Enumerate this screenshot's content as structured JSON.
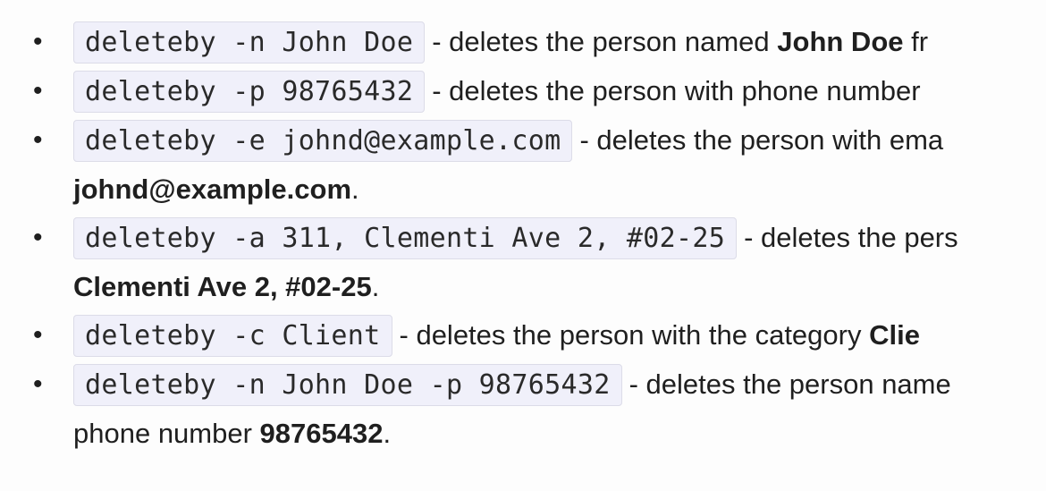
{
  "items": [
    {
      "command": "deleteby -n John Doe",
      "desc_prefix": "- deletes the person named ",
      "bold": "John Doe",
      "desc_suffix": " fr"
    },
    {
      "command": "deleteby -p 98765432",
      "desc_prefix": "- deletes the person with phone number"
    },
    {
      "command": "deleteby -e johnd@example.com",
      "desc_prefix": "- deletes the person with ema",
      "cont_bold": "johnd@example.com",
      "cont_suffix": "."
    },
    {
      "command": "deleteby -a 311, Clementi Ave 2, #02-25",
      "desc_prefix": "- deletes the pers",
      "cont_bold": "Clementi Ave 2, #02-25",
      "cont_suffix": "."
    },
    {
      "command": "deleteby -c Client",
      "desc_prefix": "- deletes the person with the category ",
      "bold": "Clie"
    },
    {
      "command": "deleteby -n John Doe -p 98765432",
      "desc_prefix": "- deletes the person name",
      "cont_text": "phone number ",
      "cont_bold": "98765432",
      "cont_suffix": "."
    }
  ],
  "bullet": "•"
}
